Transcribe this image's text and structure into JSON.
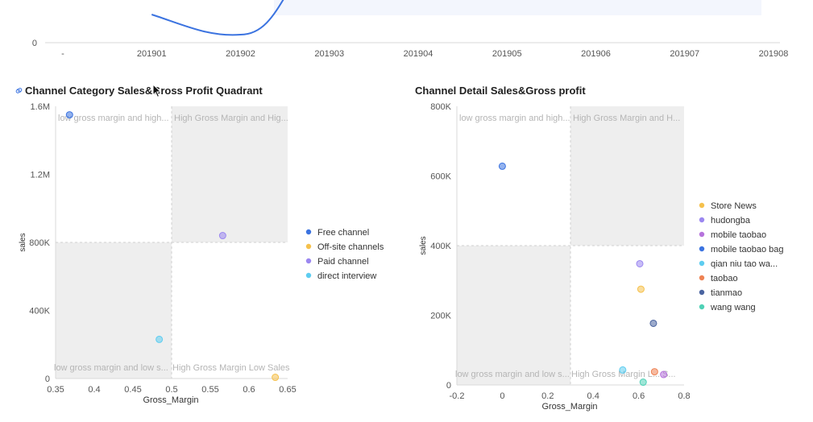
{
  "top_chart": {
    "type": "line",
    "categories": [
      "-",
      "201901",
      "201902",
      "201903",
      "201904",
      "201905",
      "201906",
      "201907",
      "201908"
    ],
    "y_tick_labels": [
      "0"
    ],
    "line_color": "#3b73e0"
  },
  "quadrant_chart": {
    "title": "Channel Category Sales&Gross Profit Quadrant",
    "icon": "link-icon",
    "xlabel": "Gross_Margin",
    "ylabel": "sales",
    "x_tick_labels": [
      "0.35",
      "0.4",
      "0.45",
      "0.5",
      "0.55",
      "0.6",
      "0.65"
    ],
    "y_tick_labels": [
      "0",
      "400K",
      "800K",
      "1.2M",
      "1.6M"
    ],
    "quadrant_labels": {
      "top_left": "low gross margin and high...",
      "top_right": "High Gross Margin and Hig...",
      "bottom_left": "low gross margin and low s...",
      "bottom_right": "High Gross Margin Low Sales"
    },
    "legend": [
      "Free channel",
      "Off-site channels",
      "Paid channel",
      "direct interview"
    ]
  },
  "detail_chart": {
    "title": "Channel Detail Sales&Gross profit",
    "xlabel": "Gross_Margin",
    "ylabel": "sales",
    "x_tick_labels": [
      "-0.2",
      "0",
      "0.2",
      "0.4",
      "0.6",
      "0.8"
    ],
    "y_tick_labels": [
      "0",
      "200K",
      "400K",
      "600K",
      "800K"
    ],
    "quadrant_labels": {
      "top_left": "low gross margin and high...",
      "top_right": "High Gross Margin and H...",
      "bottom_left": "low gross margin and low s...",
      "bottom_right": "High Gross Margin L... S..."
    },
    "legend": [
      "Store News",
      "hudongba",
      "mobile taobao",
      "mobile taobao bag",
      "qian niu tao wa...",
      "taobao",
      "tianmao",
      "wang wang"
    ]
  },
  "chart_data": [
    {
      "type": "line",
      "categories": [
        "-",
        "201901",
        "201902",
        "201903",
        "201904",
        "201905",
        "201906",
        "201907",
        "201908"
      ],
      "series": [
        {
          "values": [
            null,
            1.6,
            0.9,
            null,
            null,
            null,
            null,
            null,
            null
          ]
        }
      ]
    },
    {
      "type": "scatter",
      "title": "Channel Category Sales&Gross Profit Quadrant",
      "xlabel": "Gross_Margin",
      "ylabel": "sales",
      "xlim": [
        0.35,
        0.65
      ],
      "ylim": [
        0,
        1600000
      ],
      "quadrant_split": {
        "x": 0.5,
        "y": 800000
      },
      "series": [
        {
          "name": "Free channel",
          "color": "#3b73e0",
          "points": [
            [
              0.368,
              1550000
            ]
          ]
        },
        {
          "name": "Off-site channels",
          "color": "#f5c14d",
          "points": [
            [
              0.634,
              7000
            ]
          ]
        },
        {
          "name": "Paid channel",
          "color": "#9b87f0",
          "points": [
            [
              0.566,
              840000
            ]
          ]
        },
        {
          "name": "direct interview",
          "color": "#5ecdf0",
          "points": [
            [
              0.484,
              230000
            ]
          ]
        }
      ]
    },
    {
      "type": "scatter",
      "title": "Channel Detail Sales&Gross profit",
      "xlabel": "Gross_Margin",
      "ylabel": "sales",
      "xlim": [
        -0.2,
        0.8
      ],
      "ylim": [
        0,
        800000
      ],
      "quadrant_split": {
        "x": 0.3,
        "y": 400000
      },
      "series": [
        {
          "name": "Store News",
          "color": "#f5c14d",
          "points": [
            [
              0.61,
              275000
            ]
          ]
        },
        {
          "name": "hudongba",
          "color": "#9b87f0",
          "points": [
            [
              0.605,
              348000
            ]
          ]
        },
        {
          "name": "mobile taobao",
          "color": "#b673dc",
          "points": [
            [
              0.71,
              30000
            ]
          ]
        },
        {
          "name": "mobile taobao bag",
          "color": "#3b73e0",
          "points": [
            [
              0.0,
              628000
            ]
          ]
        },
        {
          "name": "qian niu tao wa...",
          "color": "#5ecdf0",
          "points": [
            [
              0.53,
              43000
            ]
          ]
        },
        {
          "name": "taobao",
          "color": "#ee8253",
          "points": [
            [
              0.67,
              38000
            ]
          ]
        },
        {
          "name": "tianmao",
          "color": "#4a64a0",
          "points": [
            [
              0.665,
              177000
            ]
          ]
        },
        {
          "name": "wang wang",
          "color": "#4fd1b6",
          "points": [
            [
              0.62,
              8000
            ]
          ]
        }
      ]
    }
  ]
}
